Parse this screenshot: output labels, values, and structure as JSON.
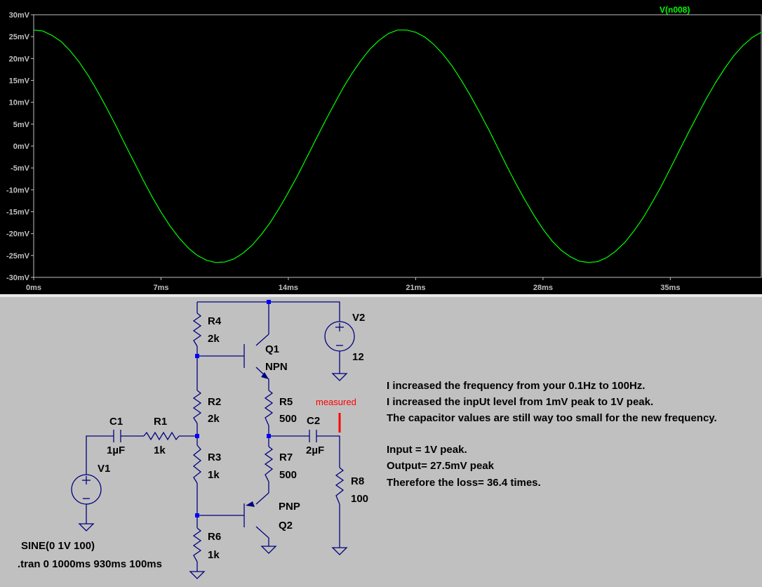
{
  "chart_data": {
    "type": "line",
    "title": "",
    "xlabel": "",
    "ylabel": "",
    "xlim": [
      0,
      40
    ],
    "ylim": [
      -30,
      30
    ],
    "x_ticks": [
      0,
      7,
      14,
      21,
      28,
      35
    ],
    "x_tick_labels": [
      "0ms",
      "7ms",
      "14ms",
      "21ms",
      "28ms",
      "35ms"
    ],
    "y_ticks": [
      30,
      25,
      20,
      15,
      10,
      5,
      0,
      -5,
      -10,
      -15,
      -20,
      -25,
      -30
    ],
    "y_tick_labels": [
      "30mV",
      "25mV",
      "20mV",
      "15mV",
      "10mV",
      "5mV",
      "0mV",
      "-5mV",
      "-10mV",
      "-15mV",
      "-20mV",
      "-25mV",
      "-30mV"
    ],
    "series": [
      {
        "name": "V(n008)",
        "color": "#00ff00",
        "x_unit": "ms",
        "y_unit": "mV",
        "x": [
          0,
          0.5,
          1,
          1.5,
          2,
          2.5,
          3,
          3.5,
          4,
          4.5,
          5,
          5.5,
          6,
          6.5,
          7,
          7.5,
          8,
          8.5,
          9,
          9.5,
          10,
          10.5,
          11,
          11.5,
          12,
          12.5,
          13,
          13.5,
          14,
          14.5,
          15,
          15.5,
          16,
          16.5,
          17,
          17.5,
          18,
          18.5,
          19,
          19.5,
          20,
          20.5,
          21,
          21.5,
          22,
          22.5,
          23,
          23.5,
          24,
          24.5,
          25,
          25.5,
          26,
          26.5,
          27,
          27.5,
          28,
          28.5,
          29,
          29.5,
          30,
          30.5,
          31,
          31.5,
          32,
          32.5,
          33,
          33.5,
          34,
          34.5,
          35,
          35.5,
          36,
          36.5,
          37,
          37.5,
          38,
          38.5,
          39,
          39.5,
          40
        ],
        "y": [
          26.5,
          26.3,
          25.3,
          23.9,
          21.8,
          19.2,
          16.1,
          12.6,
          8.8,
          4.8,
          0.6,
          -3.5,
          -7.6,
          -11.5,
          -15.1,
          -18.3,
          -21.0,
          -23.3,
          -25.0,
          -26.1,
          -26.6,
          -26.5,
          -25.8,
          -24.5,
          -22.7,
          -20.3,
          -17.5,
          -14.2,
          -10.6,
          -6.8,
          -2.7,
          1.4,
          5.5,
          9.4,
          13.2,
          16.6,
          19.6,
          22.2,
          24.2,
          25.7,
          26.5,
          26.5,
          26.0,
          24.9,
          23.2,
          21.0,
          18.3,
          15.1,
          11.6,
          7.8,
          3.9,
          -0.3,
          -4.5,
          -8.5,
          -12.3,
          -15.8,
          -19.0,
          -21.7,
          -23.8,
          -25.3,
          -26.3,
          -26.6,
          -26.4,
          -25.5,
          -24.0,
          -22.0,
          -19.4,
          -16.4,
          -12.9,
          -9.2,
          -5.1,
          -1.0,
          3.1,
          7.1,
          11.0,
          14.6,
          17.8,
          20.7,
          23.0,
          24.8,
          26.0
        ],
        "legend_text": "V(n008)"
      }
    ],
    "grid": false,
    "background": "#000000"
  },
  "schematic": {
    "background": "#c0c0c0",
    "wire_color": "#000080",
    "node_color": "#0000ff",
    "components": {
      "r4": {
        "name": "R4",
        "value": "2k"
      },
      "r2": {
        "name": "R2",
        "value": "2k"
      },
      "r3": {
        "name": "R3",
        "value": "1k"
      },
      "r6": {
        "name": "R6",
        "value": "1k"
      },
      "r5": {
        "name": "R5",
        "value": "500"
      },
      "r7": {
        "name": "R7",
        "value": "500"
      },
      "r8": {
        "name": "R8",
        "value": "100"
      },
      "r1": {
        "name": "R1",
        "value": "1k"
      },
      "c1": {
        "name": "C1",
        "value": "1µF"
      },
      "c2": {
        "name": "C2",
        "value": "2µF"
      },
      "q1": {
        "name": "Q1",
        "value": "NPN"
      },
      "q2": {
        "name": "Q2",
        "value": "PNP"
      },
      "v1": {
        "name": "V1"
      },
      "v2": {
        "name": "V2",
        "value": "12"
      }
    },
    "measured_label": "measured",
    "measured_color": "#ff0000",
    "directive_sine": "SINE(0 1V 100)",
    "directive_tran": ".tran 0 1000ms 930ms 100ms",
    "notes": [
      "I increased the frequency from your 0.1Hz to 100Hz.",
      "I increased the inpUt level from 1mV peak to 1V peak.",
      "The capacitor values are still way too small for the new frequency.",
      "",
      "Input = 1V peak.",
      "Output= 27.5mV peak",
      "Therefore the loss= 36.4 times."
    ]
  }
}
